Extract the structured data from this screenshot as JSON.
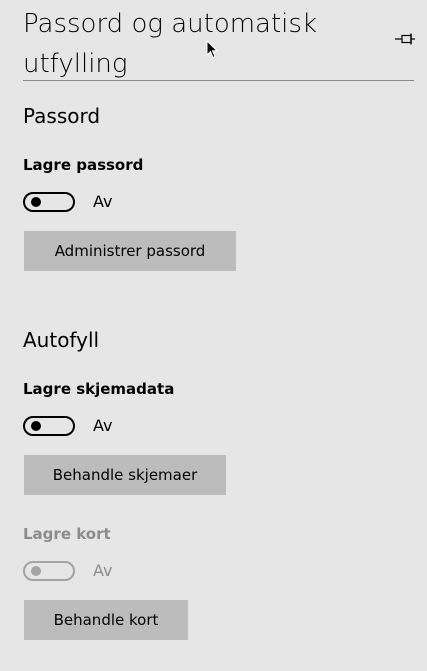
{
  "header": {
    "title": "Passord og automatisk utfylling"
  },
  "passwords": {
    "heading": "Passord",
    "save_label": "Lagre passord",
    "save_state": "Av",
    "manage_button": "Administrer passord"
  },
  "autofill": {
    "heading": "Autofyll",
    "forms_label": "Lagre skjemadata",
    "forms_state": "Av",
    "forms_button": "Behandle skjemaer",
    "cards_label": "Lagre kort",
    "cards_state": "Av",
    "cards_button": "Behandle kort"
  },
  "icons": {
    "pin": "pin-icon",
    "cursor": "mouse-cursor-icon"
  }
}
